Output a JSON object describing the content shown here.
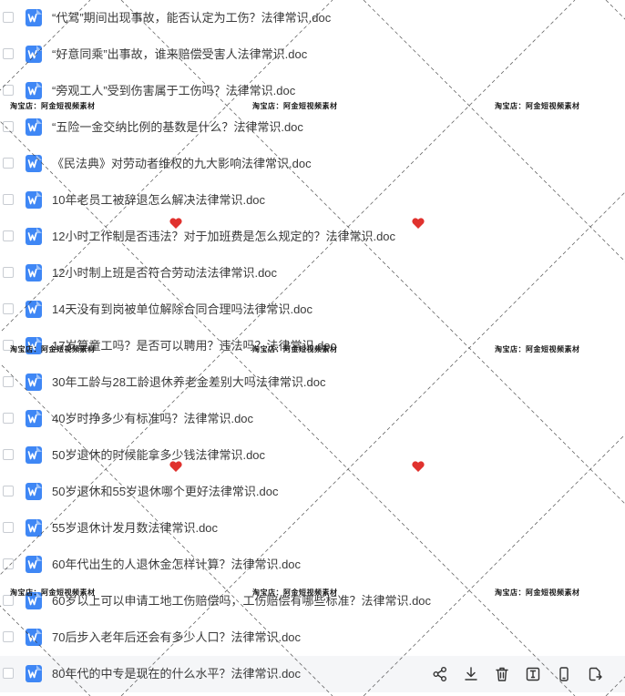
{
  "files": [
    {
      "name": "“代驾”期间出现事故，能否认定为工伤？法律常识.doc"
    },
    {
      "name": "“好意同乘”出事故，谁来赔偿受害人法律常识.doc"
    },
    {
      "name": "“旁观工人”受到伤害属于工伤吗？法律常识.doc"
    },
    {
      "name": "“五险一金交纳比例的基数是什么？法律常识.doc"
    },
    {
      "name": "《民法典》对劳动者维权的九大影响法律常识.doc"
    },
    {
      "name": "10年老员工被辞退怎么解决法律常识.doc"
    },
    {
      "name": "12小时工作制是否违法？对于加班费是怎么规定的？法律常识.doc"
    },
    {
      "name": "12小时制上班是否符合劳动法法律常识.doc"
    },
    {
      "name": "14天没有到岗被单位解除合同合理吗法律常识.doc"
    },
    {
      "name": "17岁算童工吗？是否可以聘用？违法吗？法律常识.doc"
    },
    {
      "name": "30年工龄与28工龄退休养老金差别大吗法律常识.doc"
    },
    {
      "name": "40岁时挣多少有标准吗？法律常识.doc"
    },
    {
      "name": "50岁退休的时候能拿多少钱法律常识.doc"
    },
    {
      "name": "50岁退休和55岁退休哪个更好法律常识.doc"
    },
    {
      "name": "55岁退休计发月数法律常识.doc"
    },
    {
      "name": "60年代出生的人退休金怎样计算？法律常识.doc"
    },
    {
      "name": "60岁以上可以申请工地工伤赔偿吗，工伤赔偿有哪些标准？法律常识.doc"
    },
    {
      "name": "70后步入老年后还会有多少人口？法律常识.doc"
    },
    {
      "name": "80年代的中专是现在的什么水平？法律常识.doc"
    }
  ],
  "watermark": {
    "text": "淘宝店：阿金短视频素材"
  },
  "file_icon": {
    "letter": "W",
    "color": "#3f87f5"
  },
  "icons": {
    "share": "share-icon",
    "download": "download-icon",
    "delete": "trash-icon",
    "rename": "rename-icon",
    "mobile": "mobile-icon",
    "copy": "copy-icon"
  }
}
